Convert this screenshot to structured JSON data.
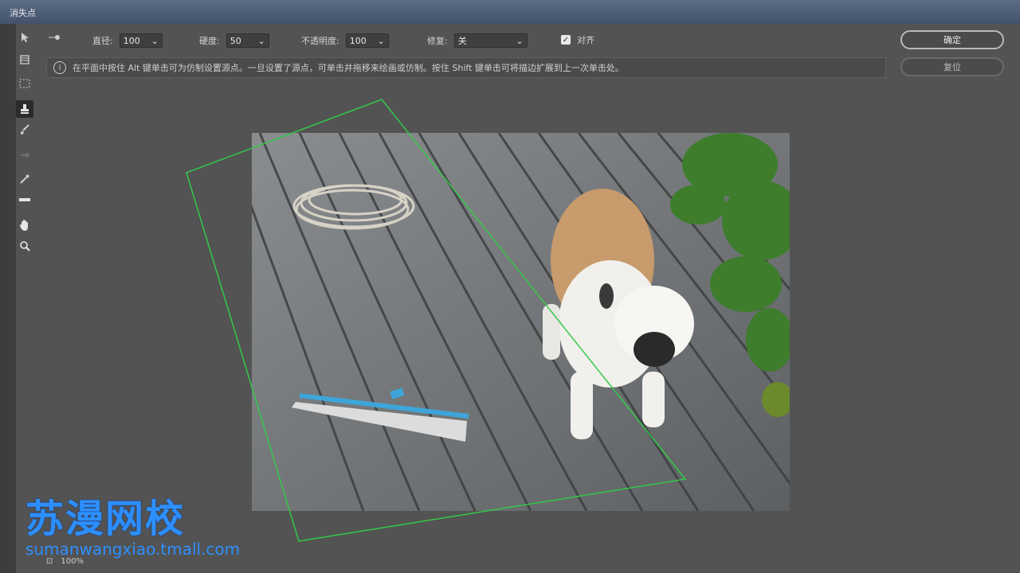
{
  "window": {
    "title": "消失点"
  },
  "tools": [
    "edit-plane",
    "create-plane",
    "marquee",
    "stamp",
    "brush",
    "transform",
    "eyedropper",
    "measure",
    "hand",
    "zoom"
  ],
  "options": {
    "diameter_label": "直径:",
    "diameter_value": "100",
    "hardness_label": "硬度:",
    "hardness_value": "50",
    "opacity_label": "不透明度:",
    "opacity_value": "100",
    "heal_label": "修复:",
    "heal_value": "关",
    "align_label": "对齐"
  },
  "info": {
    "text": "在平面中按住 Alt 键单击可为仿制设置源点。一旦设置了源点，可单击并拖移来绘画或仿制。按住 Shift 键单击可将描边扩展到上一次单击处。"
  },
  "buttons": {
    "ok": "确定",
    "reset": "复位"
  },
  "status": {
    "zoom": "100%"
  },
  "watermark": {
    "title": "苏漫网校",
    "url": "sumanwangxiao.tmall.com"
  },
  "colors": {
    "plane_grid": "#33c94a",
    "watermark": "#2d8fff"
  }
}
